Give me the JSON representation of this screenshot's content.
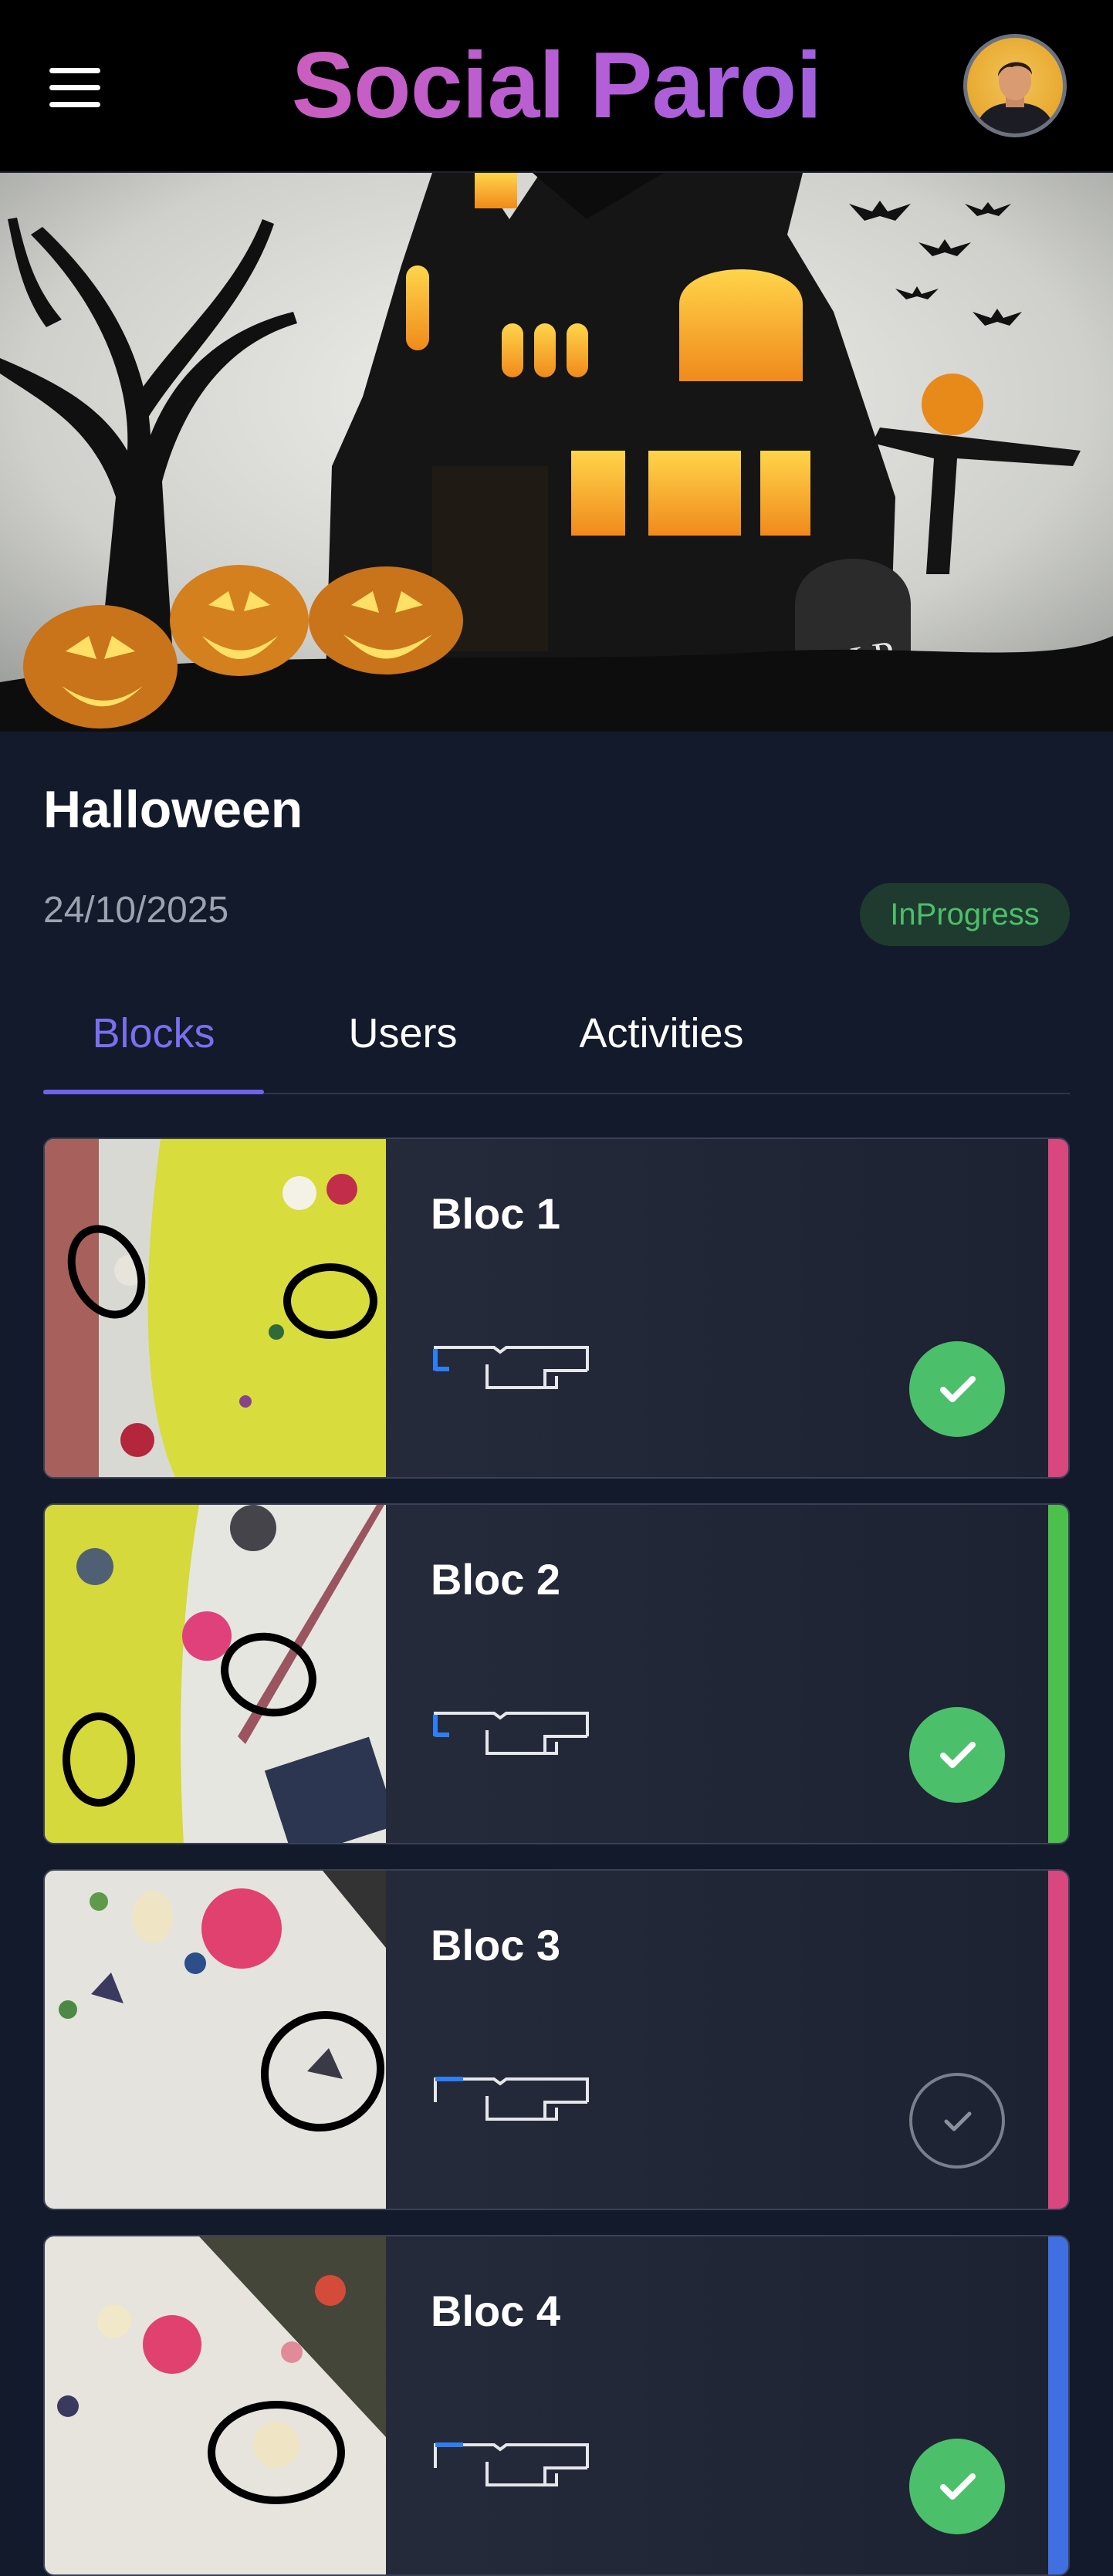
{
  "app": {
    "title": "Social Paroi"
  },
  "event": {
    "name": "Halloween",
    "date": "24/10/2025",
    "status": "InProgress",
    "banner_text": "R.I.P"
  },
  "tabs": [
    {
      "label": "Blocks",
      "active": true
    },
    {
      "label": "Users",
      "active": false
    },
    {
      "label": "Activities",
      "active": false
    }
  ],
  "blocks": [
    {
      "name": "Bloc 1",
      "completed": true,
      "stripe_color": "#d9477f",
      "grade_level": 1
    },
    {
      "name": "Bloc 2",
      "completed": true,
      "stripe_color": "#4cbf4c",
      "grade_level": 1
    },
    {
      "name": "Bloc 3",
      "completed": false,
      "stripe_color": "#d9477f",
      "grade_level": 2
    },
    {
      "name": "Bloc 4",
      "completed": true,
      "stripe_color": "#3f6fe0",
      "grade_level": 2
    }
  ],
  "colors": {
    "accent": "#6f63ea",
    "success": "#4cbf6b",
    "background": "#131a2b"
  },
  "icons": {
    "menu": "menu-icon",
    "check": "check-icon",
    "grade": "grade-scale-icon"
  }
}
